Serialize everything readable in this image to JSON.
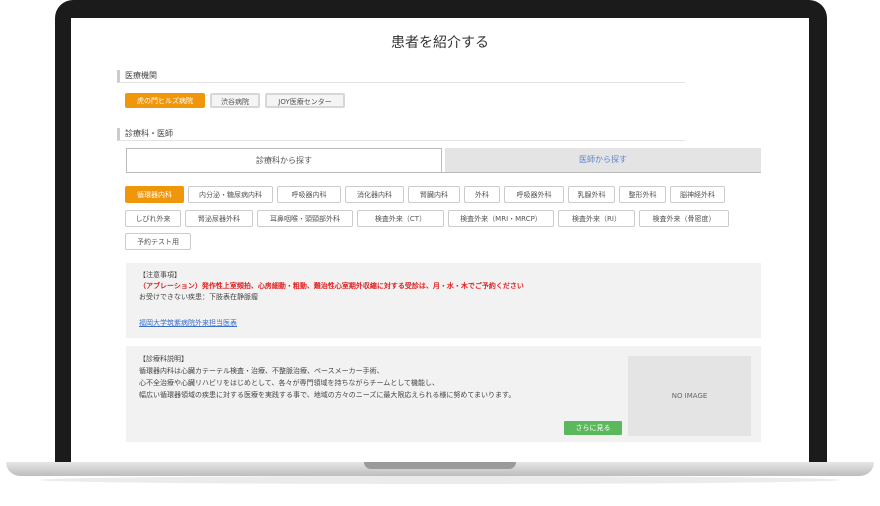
{
  "page_title": "患者を紹介する",
  "sections": {
    "institution_label": "医療機関",
    "department_label": "診療科・医師"
  },
  "institutions": [
    {
      "label": "虎の門ヒルズ病院",
      "active": true
    },
    {
      "label": "渋谷病院",
      "active": false
    },
    {
      "label": "JOY医療センター",
      "active": false
    }
  ],
  "tabs": {
    "by_department": "診療科から探す",
    "by_doctor": "医師から探す"
  },
  "departments_row1": [
    "循環器内科",
    "内分泌・糖尿病内科",
    "呼吸器内科",
    "消化器内科",
    "腎臓内科",
    "外科",
    "呼吸器外科",
    "乳腺外科",
    "整形外科",
    "脳神経外科"
  ],
  "departments_row2": [
    "しびれ外来",
    "腎泌尿器外科",
    "耳鼻咽喉・頭頸部外科",
    "検査外来（CT）",
    "検査外来（MRI・MRCP）",
    "検査外来（RI）",
    "検査外来（骨密度）"
  ],
  "departments_row3": [
    "予約テスト用"
  ],
  "notice": {
    "heading": "【注意事項】",
    "warning": "（アブレーション）発作性上室頻拍、心房細動・粗動、難治性心室期外収縮に対する受診は、月・水・木でご予約ください",
    "unavailable": "お受けできない疾患：下肢表在静脈瘤",
    "link": "福岡大学筑紫病院外来担当医表"
  },
  "description": {
    "heading": "【診療科説明】",
    "lines": [
      "循環器内科は心臓カテーテル検査・治療、不整脈治療、ペースメーカー手術、",
      "心不全治療や心臓リハビリをはじめとして、各々が専門領域を持ちながらチームとして機能し、",
      "幅広い循環器領域の疾患に対する医療を実践する事で、地域の方々のニーズに最大限応えられる様に努めてまいります。"
    ],
    "image_placeholder": "NO IMAGE",
    "more_button": "さらに見る"
  },
  "colors": {
    "accent": "#f0960a",
    "link": "#3a6ec8",
    "warning": "#e02020",
    "button_green": "#5cb85c"
  }
}
